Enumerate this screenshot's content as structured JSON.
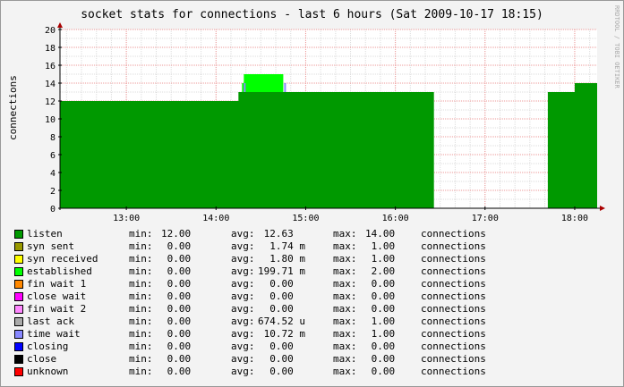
{
  "chart_data": {
    "type": "area",
    "title": "socket stats for connections - last 6 hours (Sat 2009-10-17 18:15)",
    "ylabel": "connections",
    "xlabel": "",
    "watermark": "RRDTOOL / TOBI OETIKER",
    "ylim": [
      0,
      20
    ],
    "yticks": [
      "0",
      "2",
      "4",
      "6",
      "8",
      "10",
      "12",
      "14",
      "16",
      "18",
      "20"
    ],
    "xticks": [
      "13:00",
      "14:00",
      "15:00",
      "16:00",
      "17:00",
      "18:00"
    ],
    "xtick_hours": [
      13,
      14,
      15,
      16,
      17,
      18
    ],
    "xlim_hours": [
      12.26,
      18.25
    ],
    "grid": true,
    "series": [
      {
        "name": "listen",
        "color": "#009900",
        "points": [
          [
            12.26,
            12
          ],
          [
            14.25,
            12
          ],
          [
            14.25,
            13
          ],
          [
            16.43,
            13
          ],
          [
            16.43,
            0
          ],
          [
            17.7,
            0
          ],
          [
            17.7,
            13
          ],
          [
            18.0,
            13
          ],
          [
            18.0,
            14
          ],
          [
            18.25,
            14
          ]
        ]
      },
      {
        "name": "established",
        "color": "#00ff00",
        "points": [
          [
            14.29,
            0
          ],
          [
            14.29,
            1
          ],
          [
            14.31,
            1
          ],
          [
            14.31,
            2
          ],
          [
            14.75,
            2
          ],
          [
            14.75,
            0
          ]
        ]
      },
      {
        "name": "time wait",
        "color": "#8888ff",
        "points": [
          [
            14.31,
            0
          ],
          [
            14.31,
            1
          ],
          [
            14.33,
            1
          ],
          [
            14.33,
            0
          ],
          [
            14.76,
            0
          ],
          [
            14.76,
            1
          ],
          [
            14.78,
            1
          ],
          [
            14.78,
            0
          ]
        ]
      }
    ],
    "legend": [
      {
        "name": "listen",
        "color": "#009900",
        "min": "12.00",
        "avg": " 12.63  ",
        "max": "14.00",
        "unit": "connections"
      },
      {
        "name": "syn sent",
        "color": "#999900",
        "min": " 0.00",
        "avg": "  1.74 m",
        "max": " 1.00",
        "unit": "connections"
      },
      {
        "name": "syn received",
        "color": "#ffff00",
        "min": " 0.00",
        "avg": "  1.80 m",
        "max": " 1.00",
        "unit": "connections"
      },
      {
        "name": "established",
        "color": "#00ff00",
        "min": " 0.00",
        "avg": "199.71 m",
        "max": " 2.00",
        "unit": "connections"
      },
      {
        "name": "fin wait 1",
        "color": "#ff8800",
        "min": " 0.00",
        "avg": "  0.00  ",
        "max": " 0.00",
        "unit": "connections"
      },
      {
        "name": "close wait",
        "color": "#ff00ff",
        "min": " 0.00",
        "avg": "  0.00  ",
        "max": " 0.00",
        "unit": "connections"
      },
      {
        "name": "fin wait 2",
        "color": "#ff88ff",
        "min": " 0.00",
        "avg": "  0.00  ",
        "max": " 0.00",
        "unit": "connections"
      },
      {
        "name": "last ack",
        "color": "#aaaaaa",
        "min": " 0.00",
        "avg": "674.52 u",
        "max": " 1.00",
        "unit": "connections"
      },
      {
        "name": "time wait",
        "color": "#8888ff",
        "min": " 0.00",
        "avg": " 10.72 m",
        "max": " 1.00",
        "unit": "connections"
      },
      {
        "name": "closing",
        "color": "#0000ff",
        "min": " 0.00",
        "avg": "  0.00  ",
        "max": " 0.00",
        "unit": "connections"
      },
      {
        "name": "close",
        "color": "#000000",
        "min": " 0.00",
        "avg": "  0.00  ",
        "max": " 0.00",
        "unit": "connections"
      },
      {
        "name": "unknown",
        "color": "#ff0000",
        "min": " 0.00",
        "avg": "  0.00  ",
        "max": " 0.00",
        "unit": "connections"
      }
    ],
    "legend_labels": {
      "min": "min:",
      "avg": "avg:",
      "max": "max:"
    }
  }
}
